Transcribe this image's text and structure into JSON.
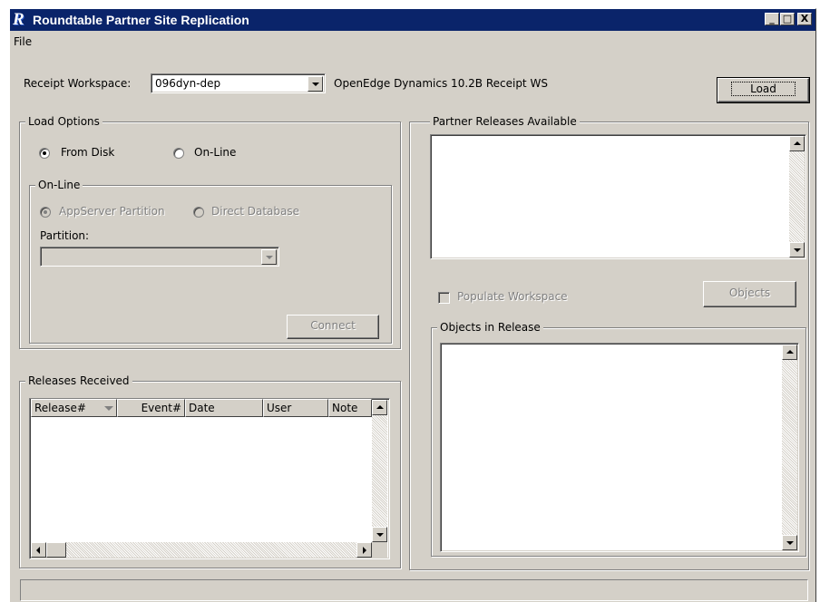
{
  "window": {
    "title": "Roundtable Partner Site Replication",
    "icon_glyph": "R",
    "controls": {
      "minimize": "_",
      "maximize": "□",
      "close": "X"
    }
  },
  "menu": {
    "file": "File"
  },
  "receipt": {
    "label": "Receipt Workspace:",
    "workspace_value": "096dyn-dep",
    "workspace_description": "OpenEdge Dynamics 10.2B Receipt WS",
    "load_button": "Load"
  },
  "load_options": {
    "title": "Load Options",
    "from_disk": "From Disk",
    "on_line": "On-Line",
    "selected": "From Disk"
  },
  "online": {
    "title": "On-Line",
    "appserver_partition": "AppServer Partition",
    "direct_database": "Direct Database",
    "selected": "AppServer Partition",
    "partition_label": "Partition:",
    "partition_value": "",
    "connect_button": "Connect"
  },
  "releases_received": {
    "title": "Releases Received",
    "columns": [
      "Release#",
      "Event#",
      "Date",
      "User",
      "Note"
    ],
    "rows": []
  },
  "partner_releases": {
    "title": "Partner Releases Available",
    "items": []
  },
  "populate_workspace": {
    "label": "Populate Workspace",
    "checked": false
  },
  "objects_button": "Objects",
  "objects_in_release": {
    "title": "Objects in Release",
    "items": []
  },
  "statusbar": {
    "text": ""
  },
  "colors": {
    "face": "#d4d0c8",
    "titlebar": "#0a246a",
    "disabled_text": "#808080"
  }
}
